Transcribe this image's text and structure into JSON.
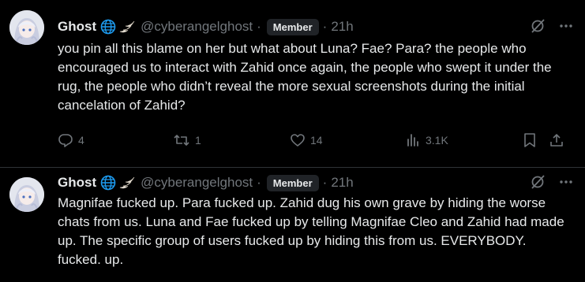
{
  "posts": [
    {
      "author": {
        "name": "Ghost",
        "handle": "@cyberangelghost",
        "badge": "Member",
        "time": "21h"
      },
      "separator_1": "·",
      "separator_2": "·",
      "text": "you pin all this blame on her but what about Luna? Fae? Para? the people who encouraged us to interact with Zahid once again, the people who swept it under the rug, the people who didn’t reveal the more sexual screenshots during the initial cancelation of Zahid?",
      "stats": {
        "replies": "4",
        "reposts": "1",
        "likes": "14",
        "views": "3.1K"
      }
    },
    {
      "author": {
        "name": "Ghost",
        "handle": "@cyberangelghost",
        "badge": "Member",
        "time": "21h"
      },
      "separator_1": "·",
      "separator_2": "·",
      "text": "Magnifae fucked up. Para fucked up. Zahid dug his own grave by hiding the worse chats from us. Luna and Fae fucked up by telling Magnifae Cleo and Zahid had made up. The specific group of users fucked up by hiding this from us. EVERYBODY. fucked. up."
    }
  ],
  "icons": {
    "globe": "globe-icon",
    "wing": "angel-wing-icon",
    "grok": "grok-icon",
    "more": "more-icon",
    "reply": "reply-icon",
    "repost": "repost-icon",
    "like": "like-icon",
    "views": "views-icon",
    "bookmark": "bookmark-icon",
    "share": "share-icon"
  },
  "colors": {
    "background": "#000000",
    "text": "#e7e9ea",
    "secondary": "#71767b",
    "divider": "#2f3336",
    "badge_bg": "#202327",
    "globe": "#1d9bf0"
  }
}
